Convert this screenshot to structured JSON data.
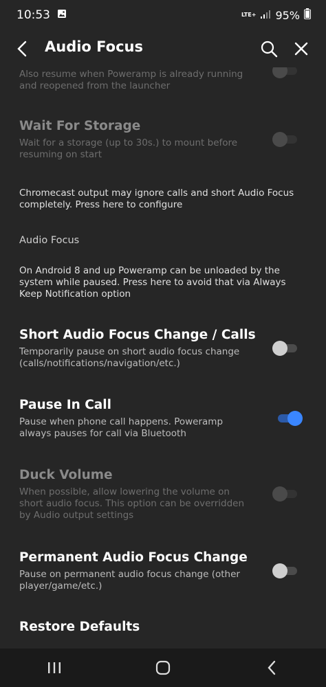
{
  "status": {
    "time": "10:53",
    "network": "LTE+",
    "battery": "95%"
  },
  "header": {
    "title": "Audio Focus"
  },
  "items": {
    "resume_partial_summary": "Also resume when Poweramp is already running and reopened from the launcher",
    "wait_storage_title": "Wait For Storage",
    "wait_storage_summary": "Wait for a storage (up to 30s.) to mount before resuming on start",
    "chromecast_info": "Chromecast output may ignore calls and short Audio Focus completely. Press here to configure",
    "category_audio_focus": "Audio Focus",
    "android8_info": "On Android 8 and up Poweramp can be unloaded by the system while paused. Press here to avoid that via Always Keep Notification option",
    "short_focus_title": "Short Audio Focus Change / Calls",
    "short_focus_summary": "Temporarily pause on short audio focus change (calls/notifications/navigation/etc.)",
    "pause_call_title": "Pause In Call",
    "pause_call_summary": "Pause when phone call happens. Poweramp always pauses for call via Bluetooth",
    "duck_title": "Duck Volume",
    "duck_summary": "When possible, allow lowering the volume on short audio focus. This option can be overridden by Audio output settings",
    "permanent_title": "Permanent Audio Focus Change",
    "permanent_summary": "Pause on permanent audio focus change (other player/game/etc.)",
    "restore_title": "Restore Defaults"
  },
  "toggles": {
    "resume_partial": false,
    "wait_storage": false,
    "short_focus": false,
    "pause_call": true,
    "duck": false,
    "permanent": false
  },
  "colors": {
    "accent": "#3a86ff",
    "background": "#262626"
  }
}
